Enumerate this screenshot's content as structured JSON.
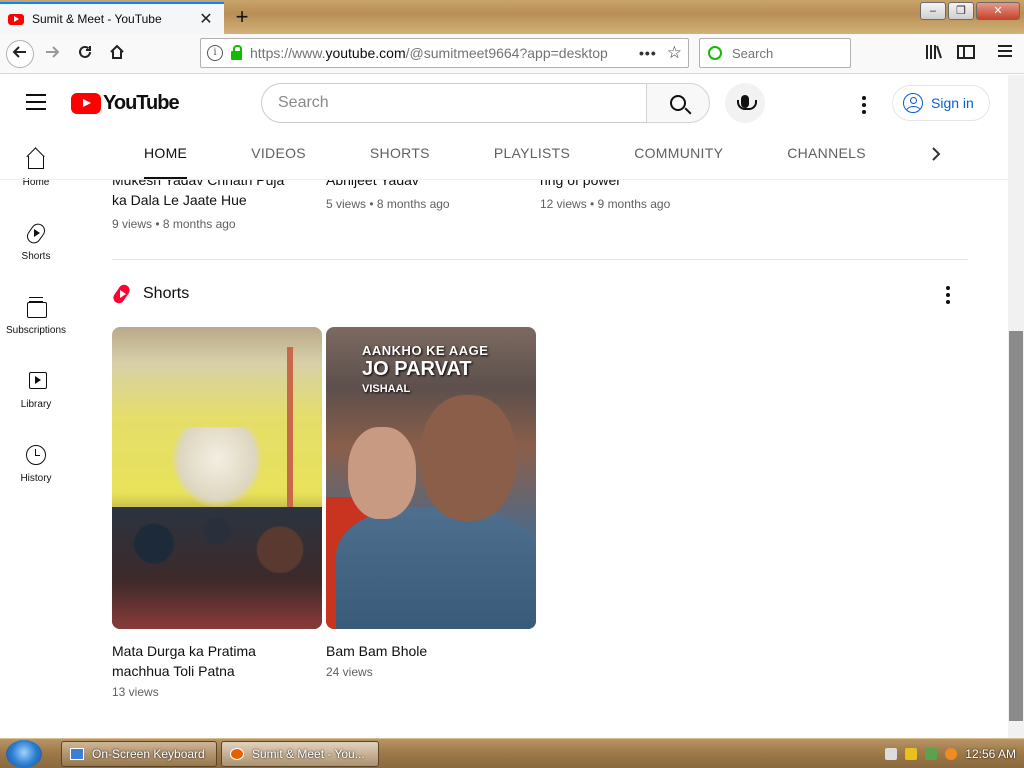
{
  "browser": {
    "tab_title": "Sumit & Meet - YouTube",
    "tab_close": "✕",
    "new_tab": "+",
    "url_prefix": "https://www.",
    "url_host": "youtube.com",
    "url_path": "/@sumitmeet9664?app=desktop",
    "search_placeholder": "Search",
    "window_controls": [
      "–",
      "❐",
      "✕"
    ]
  },
  "youtube": {
    "logo_text": "YouTube",
    "search_placeholder": "Search",
    "sign_in": "Sign in",
    "sidebar": [
      {
        "label": "Home",
        "icon": "home-icon"
      },
      {
        "label": "Shorts",
        "icon": "shorts-icon"
      },
      {
        "label": "Subscriptions",
        "icon": "subscriptions-icon"
      },
      {
        "label": "Library",
        "icon": "library-icon"
      },
      {
        "label": "History",
        "icon": "history-icon"
      }
    ],
    "channel_tabs": [
      "HOME",
      "VIDEOS",
      "SHORTS",
      "PLAYLISTS",
      "COMMUNITY",
      "CHANNELS"
    ],
    "active_tab": "HOME",
    "videos": [
      {
        "title_line1": "Mukesh Yadav Chhath Puja",
        "title_line2": "ka Dala Le Jaate Hue",
        "meta": "9 views • 8 months ago"
      },
      {
        "title_line1": "Abhijeet Yadav",
        "meta": "5 views • 8 months ago"
      },
      {
        "title_line1": "ring of power",
        "meta": "12 views • 9 months ago"
      }
    ],
    "shorts_section_title": "Shorts",
    "shorts": [
      {
        "title_line1": "Mata Durga ka Pratima",
        "title_line2": "machhua Toli Patna",
        "views": "13 views"
      },
      {
        "title_line1": "Bam Bam Bhole",
        "views": "24 views",
        "overlay": [
          "AANKHO KE AAGE",
          "JO PARVAT",
          "VISHAAL"
        ]
      }
    ]
  },
  "taskbar": {
    "items": [
      "On-Screen Keyboard",
      "Sumit & Meet - You..."
    ],
    "clock": "12:56 AM"
  },
  "colors": {
    "youtube_red": "#ff0000",
    "link_blue": "#065fd4",
    "firefox_accent": "#0a84ff"
  }
}
